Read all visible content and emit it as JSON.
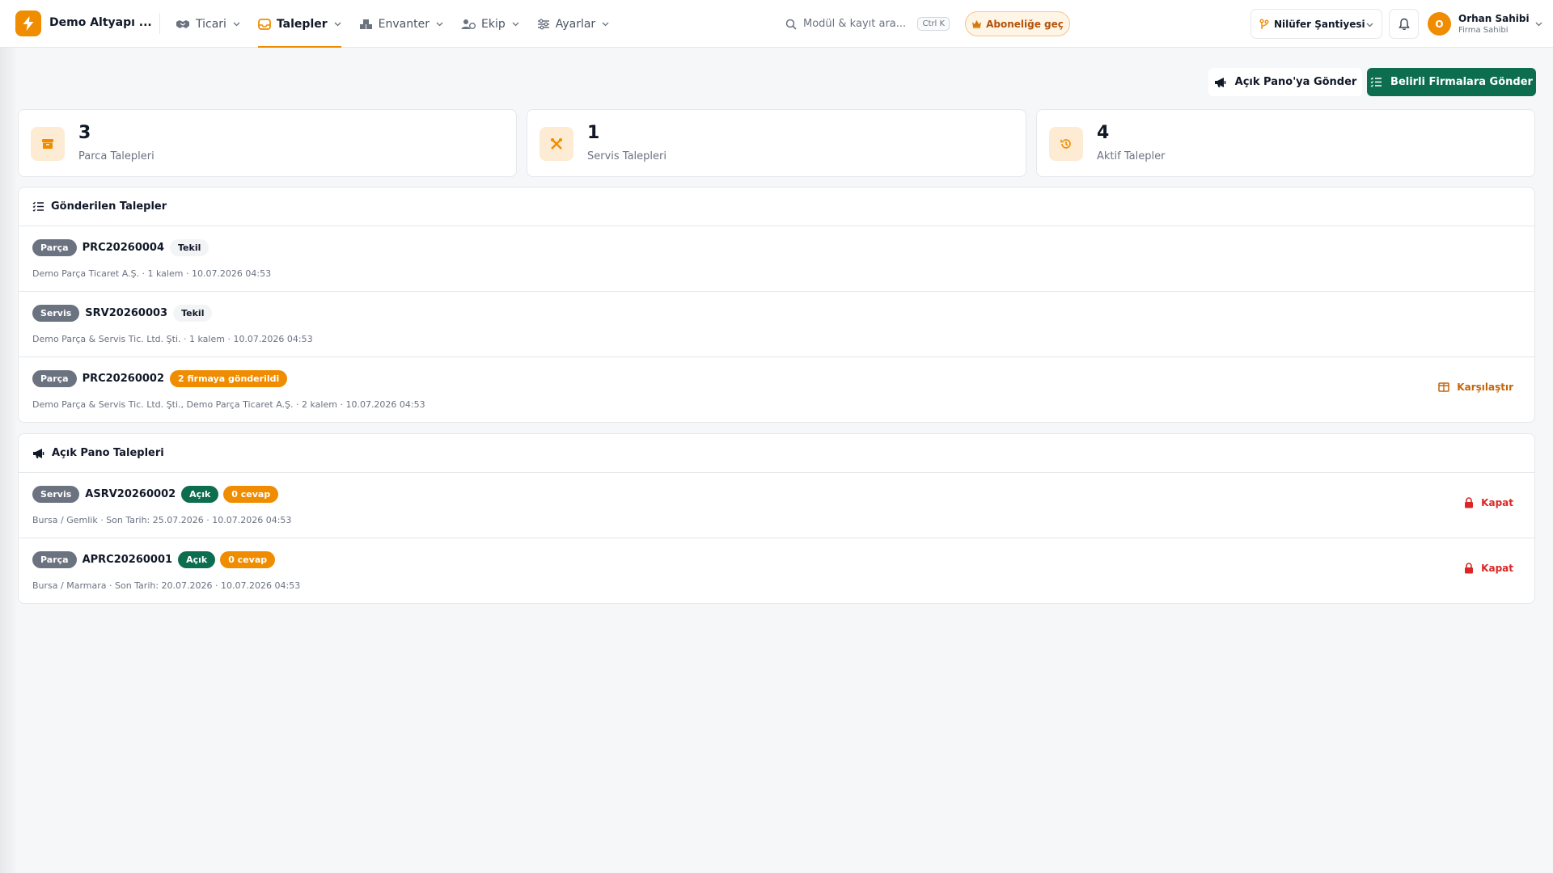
{
  "app": {
    "name": "Demo Altyapı ..."
  },
  "nav": [
    {
      "label": "Ticari",
      "active": false
    },
    {
      "label": "Talepler",
      "active": true
    },
    {
      "label": "Envanter",
      "active": false
    },
    {
      "label": "Ekip",
      "active": false
    },
    {
      "label": "Ayarlar",
      "active": false
    }
  ],
  "search": {
    "placeholder": "Modül & kayıt ara...",
    "shortcut": "Ctrl K"
  },
  "upgrade": {
    "label": "Aboneliğe geç"
  },
  "site": {
    "label": "Nilüfer Şantiyesi"
  },
  "user": {
    "initial": "O",
    "name": "Orhan Sahibi",
    "role": "Firma Sahibi"
  },
  "actions": {
    "open_board": "Açık Pano'ya Gönder",
    "send_firms": "Belirli Firmalara Gönder"
  },
  "stats": [
    {
      "value": "3",
      "label": "Parca Talepleri",
      "icon": "box-icon"
    },
    {
      "value": "1",
      "label": "Servis Talepleri",
      "icon": "tools-icon"
    },
    {
      "value": "4",
      "label": "Aktif Talepler",
      "icon": "history-icon"
    }
  ],
  "sent": {
    "title": "Gönderilen Talepler",
    "rows": [
      {
        "type": "Parça",
        "code": "PRC20260004",
        "badge": "Tekil",
        "meta": "Demo Parça Ticaret A.Ş. · 1 kalem · 10.07.2026 04:53"
      },
      {
        "type": "Servis",
        "code": "SRV20260003",
        "badge": "Tekil",
        "meta": "Demo Parça & Servis Tic. Ltd. Şti. · 1 kalem · 10.07.2026 04:53"
      },
      {
        "type": "Parça",
        "code": "PRC20260002",
        "badge": "2 firmaya gönderildi",
        "meta": "Demo Parça & Servis Tic. Ltd. Şti., Demo Parça Ticaret A.Ş. · 2 kalem · 10.07.2026 04:53",
        "action": "Karşılaştır"
      }
    ]
  },
  "board": {
    "title": "Açık Pano Talepleri",
    "rows": [
      {
        "type": "Servis",
        "code": "ASRV20260002",
        "status": "Açık",
        "replies": "0 cevap",
        "meta": "Bursa / Gemlik · Son Tarih: 25.07.2026 · 10.07.2026 04:53",
        "action": "Kapat"
      },
      {
        "type": "Parça",
        "code": "APRC20260001",
        "status": "Açık",
        "replies": "0 cevap",
        "meta": "Bursa / Marmara · Son Tarih: 20.07.2026 · 10.07.2026 04:53",
        "action": "Kapat"
      }
    ]
  }
}
